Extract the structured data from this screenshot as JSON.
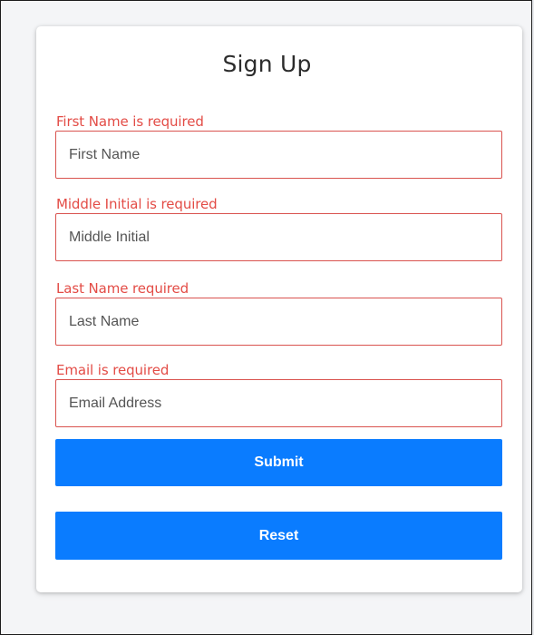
{
  "form": {
    "title": "Sign Up",
    "fields": [
      {
        "error": "First Name is required",
        "placeholder": "First Name",
        "value": ""
      },
      {
        "error": "Middle Initial is required",
        "placeholder": "Middle Initial",
        "value": ""
      },
      {
        "error": "Last Name required",
        "placeholder": "Last Name",
        "value": ""
      },
      {
        "error": "Email is required",
        "placeholder": "Email Address",
        "value": ""
      }
    ],
    "submit_label": "Submit",
    "reset_label": "Reset"
  },
  "colors": {
    "error": "#e34c46",
    "primary_button": "#0a7cff",
    "card": "#ffffff"
  }
}
